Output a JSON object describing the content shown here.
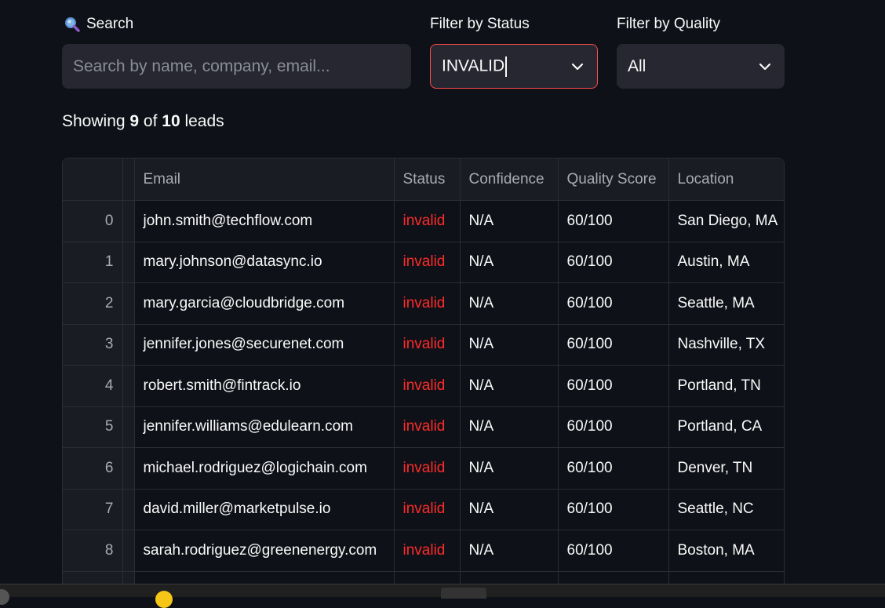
{
  "search": {
    "label": "Search",
    "placeholder": "Search by name, company, email..."
  },
  "filter_status": {
    "label": "Filter by Status",
    "value": "INVALID"
  },
  "filter_quality": {
    "label": "Filter by Quality",
    "value": "All"
  },
  "summary": {
    "prefix": "Showing ",
    "shown": "9",
    "middle": " of ",
    "total": "10",
    "suffix": " leads"
  },
  "table": {
    "columns": [
      "Email",
      "Status",
      "Confidence",
      "Quality Score",
      "Location"
    ],
    "rows": [
      {
        "index": "0",
        "email": "john.smith@techflow.com",
        "status": "invalid",
        "confidence": "N/A",
        "quality": "60/100",
        "location": "San Diego, MA"
      },
      {
        "index": "1",
        "email": "mary.johnson@datasync.io",
        "status": "invalid",
        "confidence": "N/A",
        "quality": "60/100",
        "location": "Austin, MA"
      },
      {
        "index": "2",
        "email": "mary.garcia@cloudbridge.com",
        "status": "invalid",
        "confidence": "N/A",
        "quality": "60/100",
        "location": "Seattle, MA"
      },
      {
        "index": "3",
        "email": "jennifer.jones@securenet.com",
        "status": "invalid",
        "confidence": "N/A",
        "quality": "60/100",
        "location": "Nashville, TX"
      },
      {
        "index": "4",
        "email": "robert.smith@fintrack.io",
        "status": "invalid",
        "confidence": "N/A",
        "quality": "60/100",
        "location": "Portland, TN"
      },
      {
        "index": "5",
        "email": "jennifer.williams@edulearn.com",
        "status": "invalid",
        "confidence": "N/A",
        "quality": "60/100",
        "location": "Portland, CA"
      },
      {
        "index": "6",
        "email": "michael.rodriguez@logichain.com",
        "status": "invalid",
        "confidence": "N/A",
        "quality": "60/100",
        "location": "Denver, TN"
      },
      {
        "index": "7",
        "email": "david.miller@marketpulse.io",
        "status": "invalid",
        "confidence": "N/A",
        "quality": "60/100",
        "location": "Seattle, NC"
      },
      {
        "index": "8",
        "email": "sarah.rodriguez@greenenergy.com",
        "status": "invalid",
        "confidence": "N/A",
        "quality": "60/100",
        "location": "Boston, MA"
      },
      {
        "index": "",
        "email": "",
        "status": "",
        "confidence": "",
        "quality": "",
        "location": ""
      }
    ]
  },
  "icons": {
    "search_label_icon": "magnifier-icon",
    "dropdown_icon": "chevron-down-icon"
  },
  "colors": {
    "background": "#0e1117",
    "field": "#262730",
    "accent_border": "#ff4b4b",
    "status_invalid": "#ff2b2b"
  }
}
